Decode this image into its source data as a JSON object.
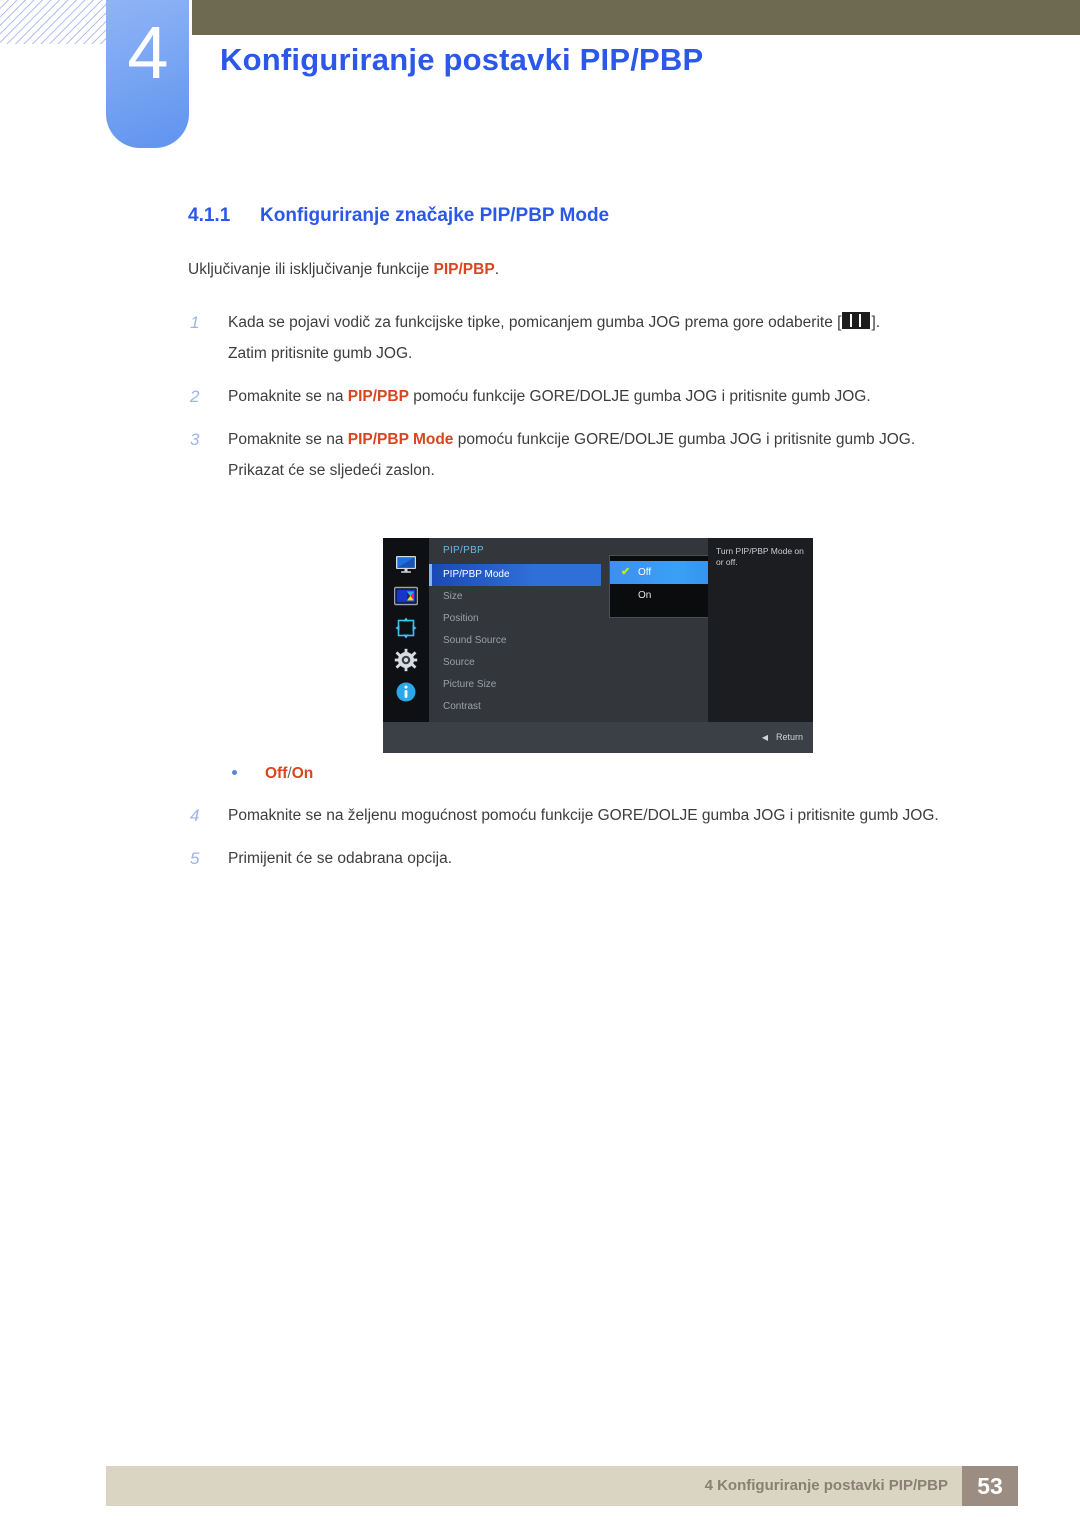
{
  "header": {
    "chapter_number": "4",
    "chapter_title": "Konfiguriranje postavki PIP/PBP"
  },
  "section": {
    "number": "4.1.1",
    "title": "Konfiguriranje značajke PIP/PBP Mode",
    "intro_before": "Uključivanje ili isključivanje funkcije ",
    "intro_highlight": "PIP/PBP",
    "intro_after": "."
  },
  "steps": [
    {
      "marker": "1",
      "text_before": "Kada se pojavi vodič za funkcijske tipke, pomicanjem gumba JOG prema gore odaberite [",
      "icon": "pip-pbp-glyph-icon",
      "text_after": "].",
      "continuation": "Zatim pritisnite gumb JOG."
    },
    {
      "marker": "2",
      "text_before": "Pomaknite se na ",
      "highlight": "PIP/PBP",
      "text_after": " pomoću funkcije GORE/DOLJE gumba JOG i pritisnite gumb JOG."
    },
    {
      "marker": "3",
      "text_before": "Pomaknite se na ",
      "highlight": "PIP/PBP Mode",
      "text_after": " pomoću funkcije GORE/DOLJE gumba JOG i pritisnite gumb JOG.",
      "continuation": "Prikazat će se sljedeći zaslon."
    },
    {
      "marker": "4",
      "text_before": "Pomaknite se na željenu mogućnost pomoću funkcije GORE/DOLJE gumba JOG i pritisnite gumb JOG."
    },
    {
      "marker": "5",
      "text_before": "Primijenit će se odabrana opcija."
    }
  ],
  "osd": {
    "menu_title": "PIP/PBP",
    "rail_icons": [
      "monitor-picture-icon",
      "pip-pbp-icon",
      "onscreen-display-position-icon",
      "system-gear-icon",
      "information-icon"
    ],
    "items": [
      {
        "label": "PIP/PBP Mode",
        "selected": true
      },
      {
        "label": "Size",
        "selected": false
      },
      {
        "label": "Position",
        "selected": false
      },
      {
        "label": "Sound Source",
        "selected": false
      },
      {
        "label": "Source",
        "selected": false
      },
      {
        "label": "Picture Size",
        "selected": false
      },
      {
        "label": "Contrast",
        "selected": false
      }
    ],
    "submenu": [
      {
        "label": "Off",
        "active": true,
        "checked": true
      },
      {
        "label": "On",
        "active": false,
        "checked": false
      }
    ],
    "description": "Turn PIP/PBP Mode on or off.",
    "return_label": "Return",
    "return_arrow": "◀",
    "check_glyph": "✔"
  },
  "bullet": {
    "option_off": "Off",
    "separator": "/",
    "option_on": "On"
  },
  "footer": {
    "text": "4 Konfiguriranje postavki PIP/PBP",
    "page": "53"
  },
  "colors": {
    "accent_blue": "#2b58e8",
    "highlight_orange": "#d9451f",
    "olive_bar": "#6e6a51",
    "tab_blue": "#7aa6f2",
    "footer_bar": "#d9d5c2",
    "page_box": "#9c8d83"
  }
}
